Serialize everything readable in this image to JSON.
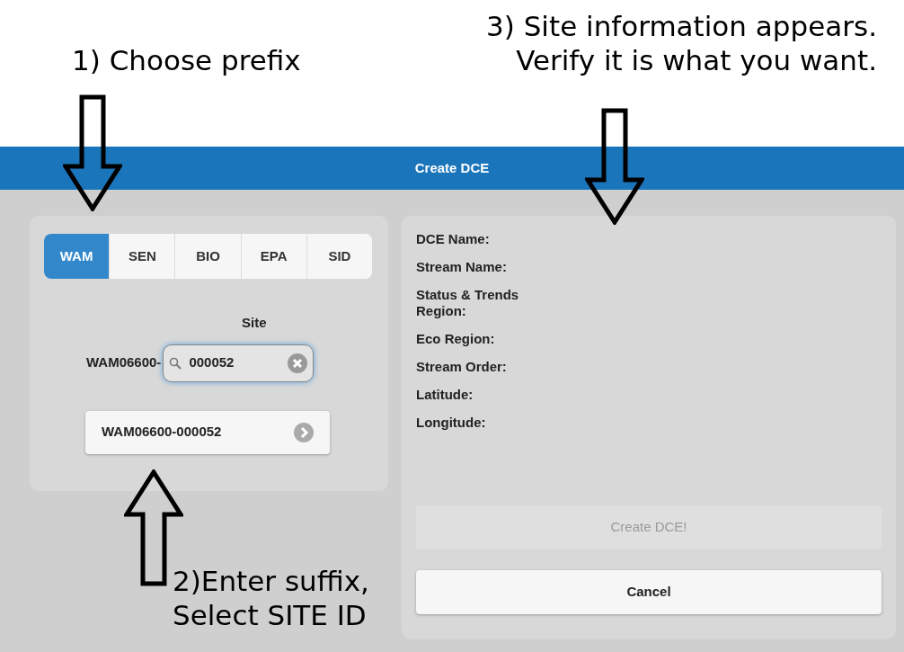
{
  "annotations": [
    {
      "lines": [
        "1) Choose prefix"
      ],
      "kind": "down"
    },
    {
      "lines": [
        "3) Site information appears.",
        "Verify it is what you want."
      ],
      "kind": "down"
    },
    {
      "lines": [
        "2)Enter suffix,",
        "Select SITE ID"
      ],
      "kind": "up"
    }
  ],
  "header": {
    "title": "Create DCE"
  },
  "prefix_tabs": [
    {
      "label": "WAM",
      "selected": true
    },
    {
      "label": "SEN",
      "selected": false
    },
    {
      "label": "BIO",
      "selected": false
    },
    {
      "label": "EPA",
      "selected": false
    },
    {
      "label": "SID",
      "selected": false
    }
  ],
  "site": {
    "label": "Site",
    "prefix": "WAM06600-",
    "value": "000052"
  },
  "results": [
    "WAM06600-000052"
  ],
  "details": [
    "DCE Name:",
    "Stream Name:",
    "Status & Trends Region:",
    "Eco Region:",
    "Stream Order:",
    "Latitude:",
    "Longitude:"
  ],
  "buttons": [
    {
      "label": "Create DCE!",
      "disabled": true
    },
    {
      "label": "Cancel",
      "disabled": false
    }
  ]
}
